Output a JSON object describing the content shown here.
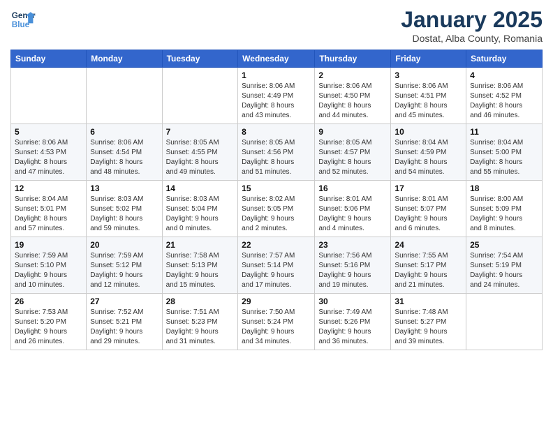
{
  "header": {
    "logo_line1": "General",
    "logo_line2": "Blue",
    "month": "January 2025",
    "location": "Dostat, Alba County, Romania"
  },
  "weekdays": [
    "Sunday",
    "Monday",
    "Tuesday",
    "Wednesday",
    "Thursday",
    "Friday",
    "Saturday"
  ],
  "weeks": [
    [
      {
        "day": "",
        "info": ""
      },
      {
        "day": "",
        "info": ""
      },
      {
        "day": "",
        "info": ""
      },
      {
        "day": "1",
        "info": "Sunrise: 8:06 AM\nSunset: 4:49 PM\nDaylight: 8 hours\nand 43 minutes."
      },
      {
        "day": "2",
        "info": "Sunrise: 8:06 AM\nSunset: 4:50 PM\nDaylight: 8 hours\nand 44 minutes."
      },
      {
        "day": "3",
        "info": "Sunrise: 8:06 AM\nSunset: 4:51 PM\nDaylight: 8 hours\nand 45 minutes."
      },
      {
        "day": "4",
        "info": "Sunrise: 8:06 AM\nSunset: 4:52 PM\nDaylight: 8 hours\nand 46 minutes."
      }
    ],
    [
      {
        "day": "5",
        "info": "Sunrise: 8:06 AM\nSunset: 4:53 PM\nDaylight: 8 hours\nand 47 minutes."
      },
      {
        "day": "6",
        "info": "Sunrise: 8:06 AM\nSunset: 4:54 PM\nDaylight: 8 hours\nand 48 minutes."
      },
      {
        "day": "7",
        "info": "Sunrise: 8:05 AM\nSunset: 4:55 PM\nDaylight: 8 hours\nand 49 minutes."
      },
      {
        "day": "8",
        "info": "Sunrise: 8:05 AM\nSunset: 4:56 PM\nDaylight: 8 hours\nand 51 minutes."
      },
      {
        "day": "9",
        "info": "Sunrise: 8:05 AM\nSunset: 4:57 PM\nDaylight: 8 hours\nand 52 minutes."
      },
      {
        "day": "10",
        "info": "Sunrise: 8:04 AM\nSunset: 4:59 PM\nDaylight: 8 hours\nand 54 minutes."
      },
      {
        "day": "11",
        "info": "Sunrise: 8:04 AM\nSunset: 5:00 PM\nDaylight: 8 hours\nand 55 minutes."
      }
    ],
    [
      {
        "day": "12",
        "info": "Sunrise: 8:04 AM\nSunset: 5:01 PM\nDaylight: 8 hours\nand 57 minutes."
      },
      {
        "day": "13",
        "info": "Sunrise: 8:03 AM\nSunset: 5:02 PM\nDaylight: 8 hours\nand 59 minutes."
      },
      {
        "day": "14",
        "info": "Sunrise: 8:03 AM\nSunset: 5:04 PM\nDaylight: 9 hours\nand 0 minutes."
      },
      {
        "day": "15",
        "info": "Sunrise: 8:02 AM\nSunset: 5:05 PM\nDaylight: 9 hours\nand 2 minutes."
      },
      {
        "day": "16",
        "info": "Sunrise: 8:01 AM\nSunset: 5:06 PM\nDaylight: 9 hours\nand 4 minutes."
      },
      {
        "day": "17",
        "info": "Sunrise: 8:01 AM\nSunset: 5:07 PM\nDaylight: 9 hours\nand 6 minutes."
      },
      {
        "day": "18",
        "info": "Sunrise: 8:00 AM\nSunset: 5:09 PM\nDaylight: 9 hours\nand 8 minutes."
      }
    ],
    [
      {
        "day": "19",
        "info": "Sunrise: 7:59 AM\nSunset: 5:10 PM\nDaylight: 9 hours\nand 10 minutes."
      },
      {
        "day": "20",
        "info": "Sunrise: 7:59 AM\nSunset: 5:12 PM\nDaylight: 9 hours\nand 12 minutes."
      },
      {
        "day": "21",
        "info": "Sunrise: 7:58 AM\nSunset: 5:13 PM\nDaylight: 9 hours\nand 15 minutes."
      },
      {
        "day": "22",
        "info": "Sunrise: 7:57 AM\nSunset: 5:14 PM\nDaylight: 9 hours\nand 17 minutes."
      },
      {
        "day": "23",
        "info": "Sunrise: 7:56 AM\nSunset: 5:16 PM\nDaylight: 9 hours\nand 19 minutes."
      },
      {
        "day": "24",
        "info": "Sunrise: 7:55 AM\nSunset: 5:17 PM\nDaylight: 9 hours\nand 21 minutes."
      },
      {
        "day": "25",
        "info": "Sunrise: 7:54 AM\nSunset: 5:19 PM\nDaylight: 9 hours\nand 24 minutes."
      }
    ],
    [
      {
        "day": "26",
        "info": "Sunrise: 7:53 AM\nSunset: 5:20 PM\nDaylight: 9 hours\nand 26 minutes."
      },
      {
        "day": "27",
        "info": "Sunrise: 7:52 AM\nSunset: 5:21 PM\nDaylight: 9 hours\nand 29 minutes."
      },
      {
        "day": "28",
        "info": "Sunrise: 7:51 AM\nSunset: 5:23 PM\nDaylight: 9 hours\nand 31 minutes."
      },
      {
        "day": "29",
        "info": "Sunrise: 7:50 AM\nSunset: 5:24 PM\nDaylight: 9 hours\nand 34 minutes."
      },
      {
        "day": "30",
        "info": "Sunrise: 7:49 AM\nSunset: 5:26 PM\nDaylight: 9 hours\nand 36 minutes."
      },
      {
        "day": "31",
        "info": "Sunrise: 7:48 AM\nSunset: 5:27 PM\nDaylight: 9 hours\nand 39 minutes."
      },
      {
        "day": "",
        "info": ""
      }
    ]
  ]
}
